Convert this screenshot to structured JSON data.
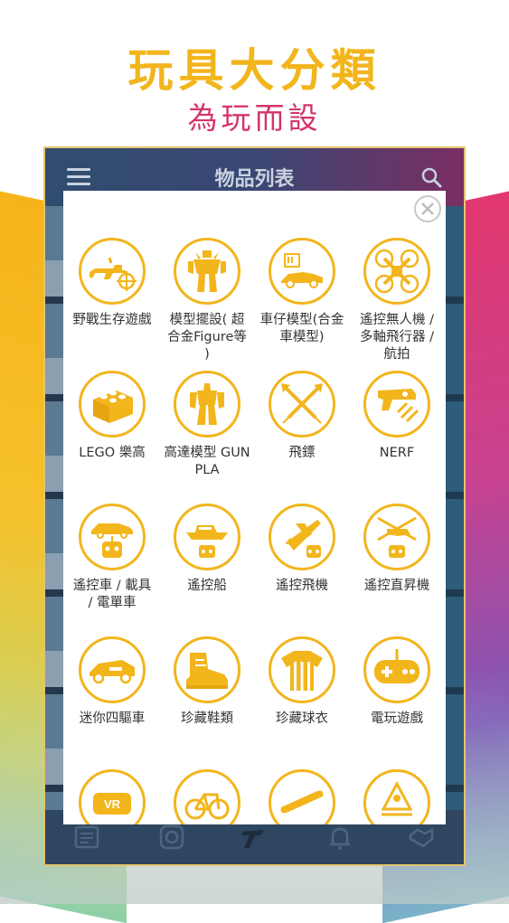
{
  "promo": {
    "headline": "玩具大分類",
    "subline": "為玩而設"
  },
  "app": {
    "title": "物品列表",
    "menu_icon": "hamburger-menu-icon",
    "search_icon": "search-icon",
    "bottom_nav": [
      "news-icon",
      "instagram-icon",
      "brand-logo-icon",
      "bell-icon",
      "handshake-icon"
    ]
  },
  "modal": {
    "close_icon": "close-icon",
    "categories": [
      {
        "label": "野戰生存遊戲",
        "icon": "rifle-target-icon"
      },
      {
        "label": "模型擺設( 超合金Figure等 )",
        "icon": "robot-figure-icon"
      },
      {
        "label": "車仔模型(合金車模型)",
        "icon": "model-car-icon"
      },
      {
        "label": "遙控無人機 / 多軸飛行器 / 航拍",
        "icon": "drone-icon"
      },
      {
        "label": "LEGO 樂高",
        "icon": "lego-brick-icon"
      },
      {
        "label": "高達模型 GUNPLA",
        "icon": "gundam-icon"
      },
      {
        "label": "飛鏢",
        "icon": "darts-icon"
      },
      {
        "label": "NERF",
        "icon": "nerf-blaster-icon"
      },
      {
        "label": "遙控車 / 載具 / 電單車",
        "icon": "rc-car-icon"
      },
      {
        "label": "遙控船",
        "icon": "rc-boat-icon"
      },
      {
        "label": "遙控飛機",
        "icon": "rc-plane-icon"
      },
      {
        "label": "遙控直昇機",
        "icon": "rc-helicopter-icon"
      },
      {
        "label": "迷你四驅車",
        "icon": "mini-4wd-icon"
      },
      {
        "label": "珍藏鞋類",
        "icon": "sneaker-icon"
      },
      {
        "label": "珍藏球衣",
        "icon": "jersey-icon"
      },
      {
        "label": "電玩遊戲",
        "icon": "gamepad-icon"
      },
      {
        "label": "",
        "icon": "vr-icon"
      },
      {
        "label": "",
        "icon": "bicycle-icon"
      },
      {
        "label": "",
        "icon": "skateboard-icon"
      },
      {
        "label": "",
        "icon": "figure-icon"
      }
    ]
  },
  "colors": {
    "accent_yellow": "#f2b51c",
    "accent_pink": "#d3346c",
    "appbar_start": "#304d6e",
    "appbar_end": "#7a2e63"
  }
}
